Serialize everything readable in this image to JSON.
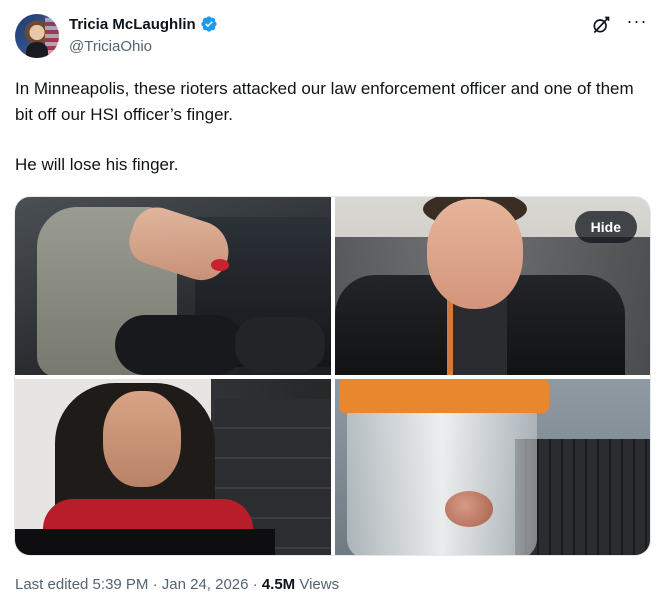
{
  "author": {
    "display_name": "Tricia McLaughlin",
    "handle": "@TriciaOhio",
    "verified": true,
    "verified_color": "#1d9bf0"
  },
  "header_actions": {
    "grok_icon": "grok-icon",
    "more_icon": "more-icon"
  },
  "tweet": {
    "paragraph_1": "In Minneapolis, these rioters attacked our law enforcement officer and one of them bit off our HSI officer’s finger.",
    "paragraph_2": "He will lose his finger."
  },
  "media": {
    "hide_label": "Hide",
    "photo_count": 4
  },
  "meta": {
    "edited_label": "Last edited 5:39 PM · Jan 24, 2026 ·",
    "views_count": "4.5M",
    "views_label": "Views"
  }
}
